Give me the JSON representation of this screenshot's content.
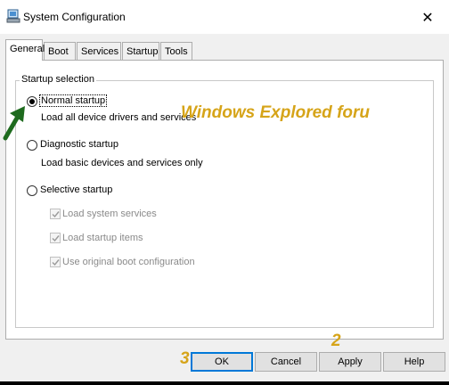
{
  "window": {
    "title": "System Configuration",
    "close_glyph": "✕"
  },
  "tabs": [
    {
      "label": "General",
      "active": true
    },
    {
      "label": "Boot"
    },
    {
      "label": "Services"
    },
    {
      "label": "Startup"
    },
    {
      "label": "Tools"
    }
  ],
  "startup": {
    "group_label": "Startup selection",
    "normal": {
      "label": "Normal startup",
      "desc": "Load all device drivers and services",
      "selected": true
    },
    "diagnostic": {
      "label": "Diagnostic startup",
      "desc": "Load basic devices and services only",
      "selected": false
    },
    "selective": {
      "label": "Selective startup",
      "selected": false,
      "options": [
        {
          "label": "Load system services",
          "checked": true,
          "enabled": false
        },
        {
          "label": "Load startup items",
          "checked": true,
          "enabled": false
        },
        {
          "label": "Use original boot configuration",
          "checked": true,
          "enabled": false
        }
      ]
    }
  },
  "buttons": {
    "ok": "OK",
    "cancel": "Cancel",
    "apply": "Apply",
    "help": "Help"
  },
  "annotations": {
    "watermark": "Windows Explored foru",
    "step_ok": "3",
    "step_apply": "2",
    "arrow_color": "#1e6b1e",
    "text_color": "#d6a419"
  },
  "icons": {
    "app": "system-config-icon",
    "close": "close-icon",
    "arrow": "arrow-icon"
  }
}
